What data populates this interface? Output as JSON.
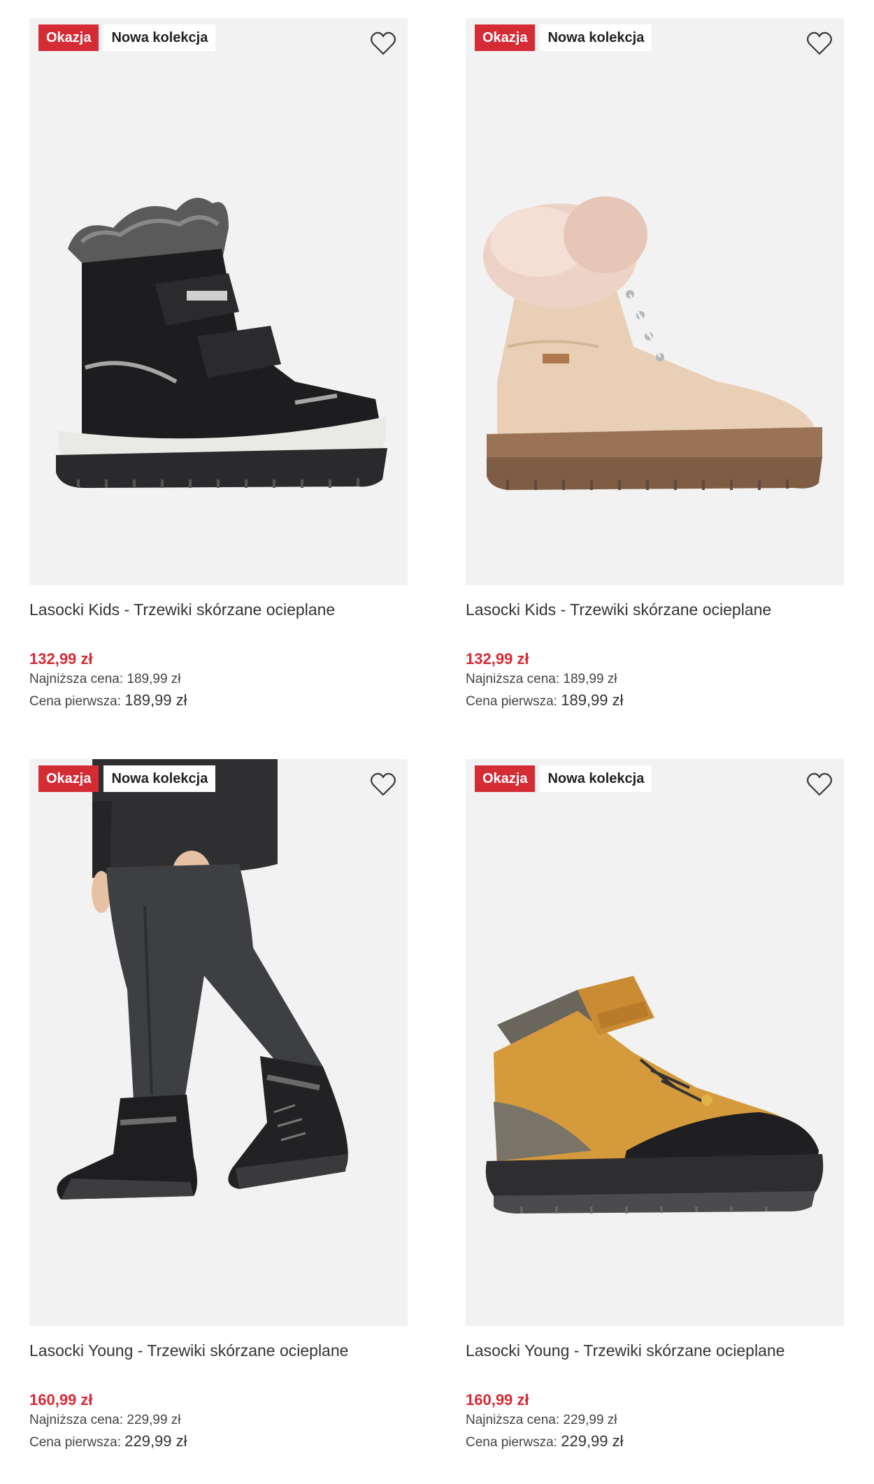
{
  "colors": {
    "accent": "#d52b35",
    "image_bg": "#f2f2f2"
  },
  "products": [
    {
      "badges": {
        "sale": "Okazja",
        "new": "Nowa kolekcja"
      },
      "favorite_icon": "heart-outline-icon",
      "image": "black winter boot with fur collar and velcro straps",
      "title": "Lasocki Kids - Trzewiki skórzane ocieplane",
      "price": "132,99 zł",
      "lowest_label": "Najniższa cena:",
      "lowest_value": "189,99 zł",
      "first_label": "Cena pierwsza:",
      "first_value": "189,99 zł"
    },
    {
      "badges": {
        "sale": "Okazja",
        "new": "Nowa kolekcja"
      },
      "favorite_icon": "heart-outline-icon",
      "image": "beige lace-up boot with pink fur collar",
      "title": "Lasocki Kids - Trzewiki skórzane ocieplane",
      "price": "132,99 zł",
      "lowest_label": "Najniższa cena:",
      "lowest_value": "189,99 zł",
      "first_label": "Cena pierwsza:",
      "first_value": "189,99 zł"
    },
    {
      "badges": {
        "sale": "Okazja",
        "new": "Nowa kolekcja"
      },
      "favorite_icon": "heart-outline-icon",
      "image": "child walking in dark trousers and black boots",
      "title": "Lasocki Young - Trzewiki skórzane ocieplane",
      "price": "160,99 zł",
      "lowest_label": "Najniższa cena:",
      "lowest_value": "229,99 zł",
      "first_label": "Cena pierwsza:",
      "first_value": "229,99 zł"
    },
    {
      "badges": {
        "sale": "Okazja",
        "new": "Nowa kolekcja"
      },
      "favorite_icon": "heart-outline-icon",
      "image": "tan and grey high-top boot with toggle laces",
      "title": "Lasocki Young - Trzewiki skórzane ocieplane",
      "price": "160,99 zł",
      "lowest_label": "Najniższa cena:",
      "lowest_value": "229,99 zł",
      "first_label": "Cena pierwsza:",
      "first_value": "229,99 zł"
    }
  ]
}
